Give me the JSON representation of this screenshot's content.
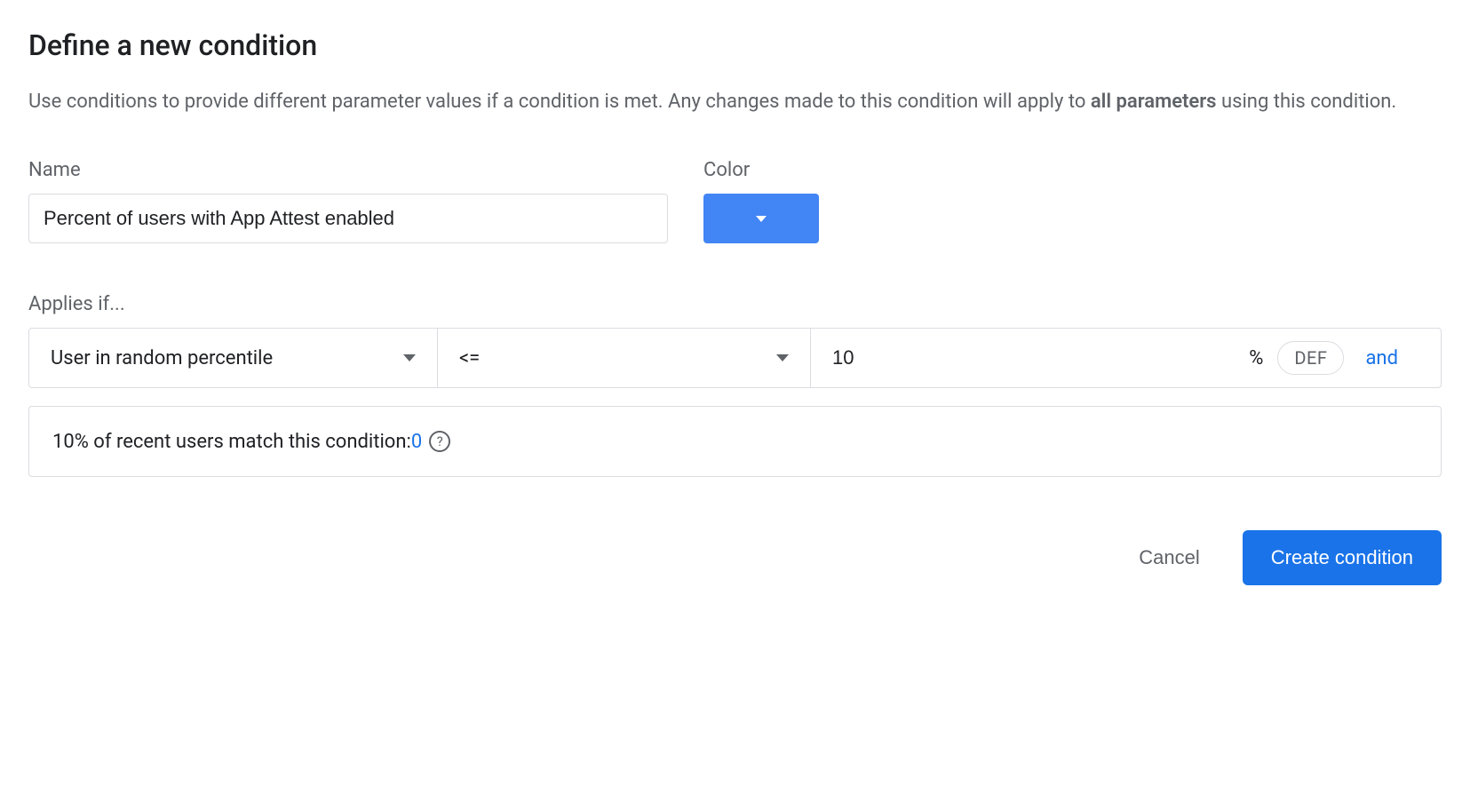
{
  "header": {
    "title": "Define a new condition",
    "description_part1": "Use conditions to provide different parameter values if a condition is met. Any changes made to this condition will apply to ",
    "description_bold": "all parameters",
    "description_part2": " using this condition."
  },
  "form": {
    "name_label": "Name",
    "name_value": "Percent of users with App Attest enabled",
    "color_label": "Color",
    "color_value": "#4285f4"
  },
  "condition": {
    "applies_label": "Applies if...",
    "type": "User in random percentile",
    "operator": "<=",
    "value": "10",
    "unit": "%",
    "def_label": "DEF",
    "and_label": "and"
  },
  "match": {
    "text_prefix": "10% of recent users match this condition: ",
    "count": "0"
  },
  "actions": {
    "cancel": "Cancel",
    "create": "Create condition"
  }
}
